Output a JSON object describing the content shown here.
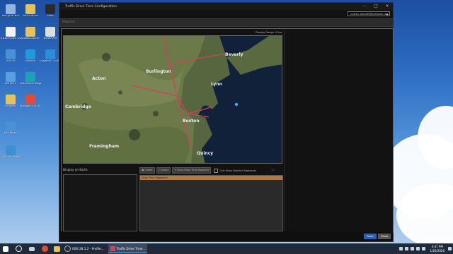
{
  "desktop_icons": [
    {
      "label": "Recycle Bin",
      "icon": "recycle-bin-icon",
      "color": "#8fb6e0"
    },
    {
      "label": "SPUCache",
      "icon": "folder-icon",
      "color": "#e7c25b"
    },
    {
      "label": "OBS",
      "icon": "obs-icon",
      "color": "#2b2b2b"
    },
    {
      "label": "TruVu Care Utilities",
      "icon": "document-icon",
      "color": "#f2f2f2"
    },
    {
      "label": "DawnCache",
      "icon": "folder-icon",
      "color": "#e7c25b"
    },
    {
      "label": "BOMAAR",
      "icon": "headphones-icon",
      "color": "#dddddd"
    },
    {
      "label": "This PC",
      "icon": "computer-icon",
      "color": "#4a90d9"
    },
    {
      "label": "Webex",
      "icon": "webex-icon",
      "color": "#1f9bd7"
    },
    {
      "label": "LogMeIn Client",
      "icon": "logmein-icon",
      "color": "#2a8fd8"
    },
    {
      "label": "WinSCP",
      "icon": "winscp-icon",
      "color": "#5aa0e0"
    },
    {
      "label": "Microsoft Edge",
      "icon": "edge-icon",
      "color": "#1ea0b8"
    },
    {
      "label": "mauser",
      "icon": "folder-icon",
      "color": "#e7c25b"
    },
    {
      "label": "Google Chrome",
      "icon": "chrome-icon",
      "color": "#e04b3b"
    },
    {
      "label": "Network",
      "icon": "network-icon",
      "color": "#4a90d9"
    },
    {
      "label": "Control Panel",
      "icon": "control-panel-icon",
      "color": "#3f8fd3"
    }
  ],
  "window": {
    "title": "Traffic Drive Time Configuration",
    "user": "kristen.barnett@example.com",
    "page_header": "Mapsize",
    "map_label": "Display Range: 0 km",
    "map_places": [
      "Beverly",
      "Burlington",
      "Acton",
      "Lynn",
      "Boston",
      "Framingham",
      "Quincy",
      "Cambridge"
    ],
    "display_on_earth": "Display on Earth",
    "toolbar": {
      "create": "Create",
      "select": "Select",
      "draw": "Draw Drive Time Segment",
      "only_show": "Only Show Selected Segments",
      "pager": "1/1"
    },
    "segments_header": "Drive Time Segments",
    "save": "Save",
    "close": "Close"
  },
  "taskbar": {
    "apps": [
      {
        "label": "OBS 28.1.2 - Profile..."
      },
      {
        "label": "Traffic Drive Time..."
      }
    ],
    "time": "3:47 PM",
    "date": "1/20/2026"
  },
  "colors": {
    "accent": "#2462b8",
    "segment_header": "#b07a40",
    "route": "#d0415a"
  }
}
